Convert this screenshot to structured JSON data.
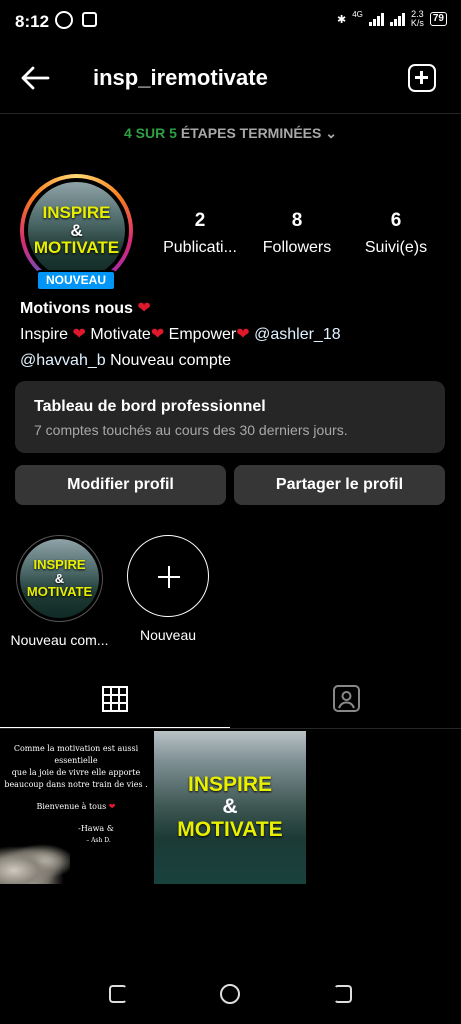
{
  "status_bar": {
    "time": "8:12",
    "network": "4G",
    "speed_value": "2.3",
    "speed_unit": "K/s",
    "battery": "79"
  },
  "header": {
    "username": "insp_iremotivate"
  },
  "steps": {
    "done": "4 SUR 5",
    "label": "ÉTAPES TERMINÉES"
  },
  "profile": {
    "avatar_line1": "INSPIRE",
    "avatar_amp": "&",
    "avatar_line2": "MOTIVATE",
    "badge": "NOUVEAU",
    "stats": [
      {
        "value": "2",
        "label": "Publicati..."
      },
      {
        "value": "8",
        "label": "Followers"
      },
      {
        "value": "6",
        "label": "Suivi(e)s"
      }
    ],
    "name": "Motivons nous",
    "bio_words": [
      "Inspire",
      "Motivate",
      "Empower"
    ],
    "mention1": "@ashler_18",
    "mention2": "@havvah_b",
    "bio_end": "Nouveau compte"
  },
  "dashboard": {
    "title": "Tableau de bord professionnel",
    "subtitle": "7 comptes touchés au cours des 30 derniers jours."
  },
  "buttons": {
    "edit": "Modifier profil",
    "share": "Partager le profil"
  },
  "highlights": [
    {
      "label": "Nouveau com..."
    },
    {
      "label": "Nouveau"
    }
  ],
  "posts": {
    "post1_lines": [
      "Comme la motivation est  aussi essentielle",
      "que  la joie de vivre elle apporte",
      "beaucoup dans notre train de vies .",
      "Bienvenue  à tous",
      "-Hawa &",
      "– Ash D."
    ],
    "post2_line1": "INSPIRE",
    "post2_amp": "&",
    "post2_line2": "MOTIVATE"
  }
}
